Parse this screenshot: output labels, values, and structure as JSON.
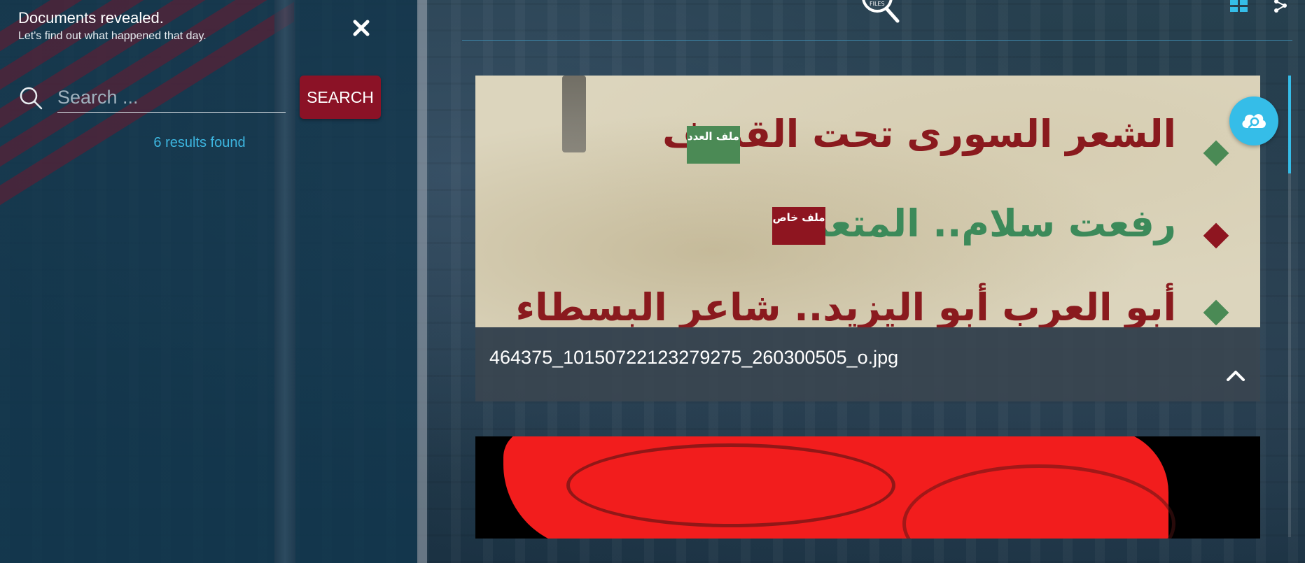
{
  "panel": {
    "title": "Documents revealed.",
    "subtitle": "Let's find out what happened that day.",
    "close_icon": "close-icon",
    "search": {
      "placeholder": "Search ...",
      "value": "",
      "button_label": "SEARCH",
      "icon": "search-icon"
    },
    "results_text": "6 results found"
  },
  "header": {
    "logo_text": "FILES",
    "view_icon": "grid-icon",
    "share_icon": "share-icon"
  },
  "results": [
    {
      "filename": "464375_10150722123279275_260300505_o.jpg",
      "image_lines": [
        "الشعر السورى تحت القصف",
        "رفعت سلام.. المتعدد",
        "أبو العرب أبو اليزيد.. شاعر البسطاء"
      ],
      "badges": [
        "ملف العدد",
        "ملف خاص"
      ],
      "toggle_icon": "chevron-up-icon"
    },
    {
      "filename": ""
    }
  ],
  "upload_icon": "cloud-search-icon",
  "colors": {
    "accent": "#35bde8",
    "search_button": "#8b1226",
    "results_text": "#3db6e0"
  }
}
